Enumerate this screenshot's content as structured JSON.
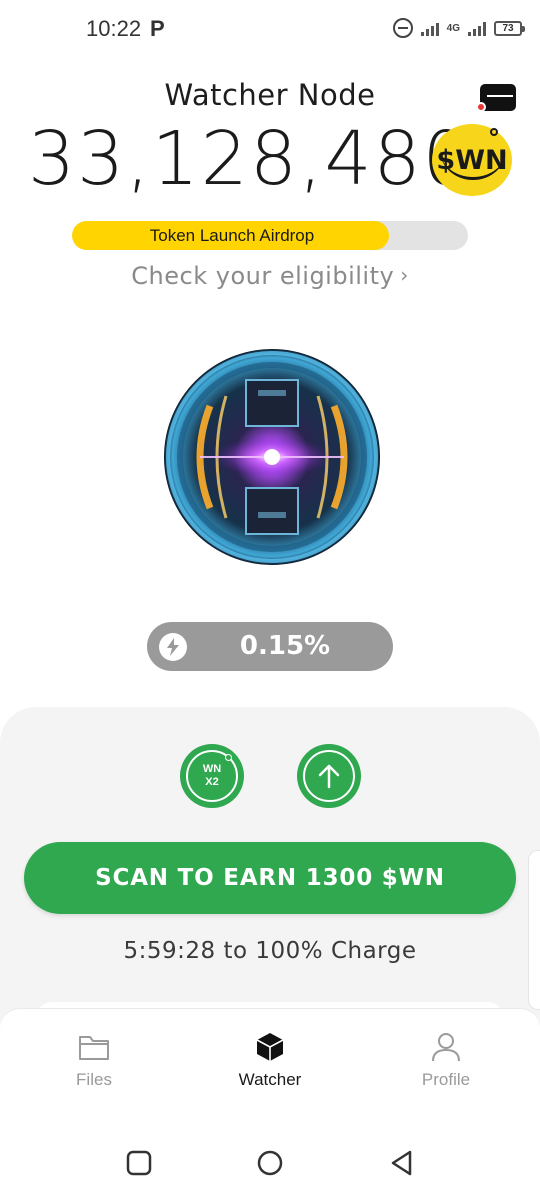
{
  "status_bar": {
    "time": "10:22",
    "carrier_icon": "P",
    "network": "4G",
    "battery": "73"
  },
  "header": {
    "title": "Watcher Node",
    "balance": "33,128,480",
    "coin_label": "$WN"
  },
  "airdrop": {
    "label": "Token Launch Airdrop",
    "progress_percent": 80,
    "eligibility_link": "Check your eligibility"
  },
  "charge": {
    "value": "0.15%"
  },
  "boosts": {
    "multiplier_label_line1": "WN",
    "multiplier_label_line2": "X2"
  },
  "scan": {
    "button_label": "SCAN TO EARN 1300 $WN",
    "time_to_full": "5:59:28 to 100% Charge"
  },
  "bottom_nav": {
    "items": [
      {
        "label": "Files",
        "icon": "folder-icon",
        "active": false
      },
      {
        "label": "Watcher",
        "icon": "cube-icon",
        "active": true
      },
      {
        "label": "Profile",
        "icon": "user-icon",
        "active": false
      }
    ]
  },
  "colors": {
    "brand_green": "#2fa84f",
    "brand_yellow": "#ffd400",
    "pill_gray": "#9a9a9a"
  }
}
